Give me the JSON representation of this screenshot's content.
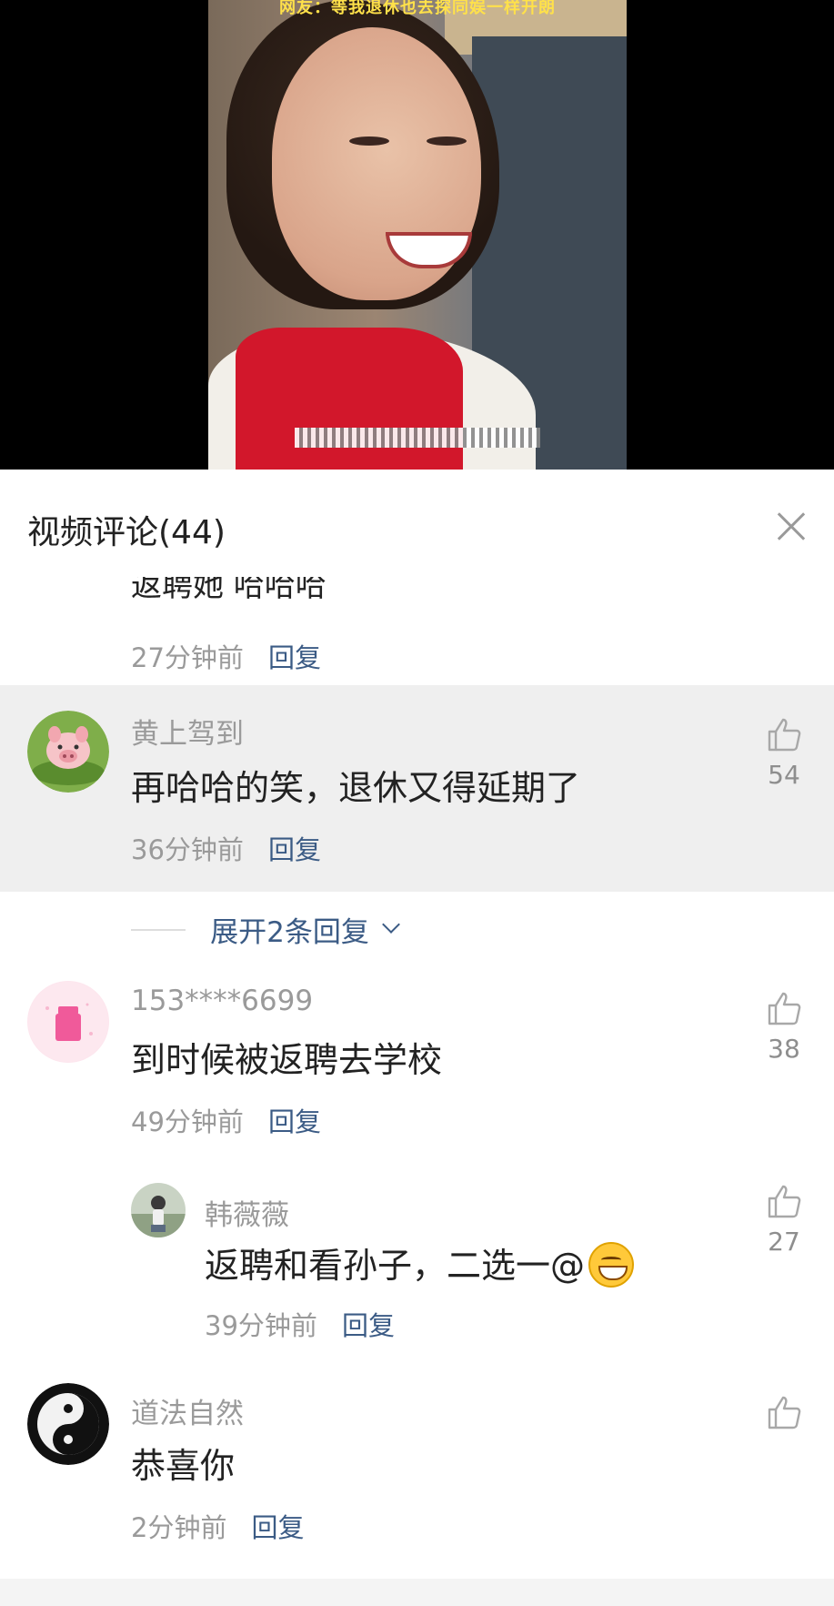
{
  "video": {
    "top_caption": "网友：等我退休也去探同娱一样开朗",
    "bottom_caption": ""
  },
  "panel": {
    "title": "视频评论(44)"
  },
  "partial_comment": {
    "content": "返聘她 哈哈哈",
    "time": "27分钟前",
    "reply_label": "回复"
  },
  "comments": [
    {
      "username": "黄上驾到",
      "content": "再哈哈的笑，退休又得延期了",
      "time": "36分钟前",
      "reply_label": "回复",
      "likes": "54",
      "avatar": "pig-avatar",
      "highlighted": true,
      "expand_label": "展开2条回复"
    },
    {
      "username": "153****6699",
      "content": "到时候被返聘去学校",
      "time": "49分钟前",
      "reply_label": "回复",
      "likes": "38",
      "avatar": "pink-cup-avatar",
      "replies": [
        {
          "username": "韩薇薇",
          "content": "返聘和看孙子，二选一@",
          "emoji": "grinning-face",
          "time": "39分钟前",
          "reply_label": "回复",
          "likes": "27",
          "avatar": "photo-avatar"
        }
      ]
    },
    {
      "username": "道法自然",
      "content": "恭喜你",
      "time": "2分钟前",
      "reply_label": "回复",
      "likes": "",
      "avatar": "yin-yang-avatar"
    }
  ],
  "colors": {
    "reply_link": "#3b5b85",
    "meta_gray": "#9a9a9a",
    "highlight_bg": "#efefef"
  }
}
